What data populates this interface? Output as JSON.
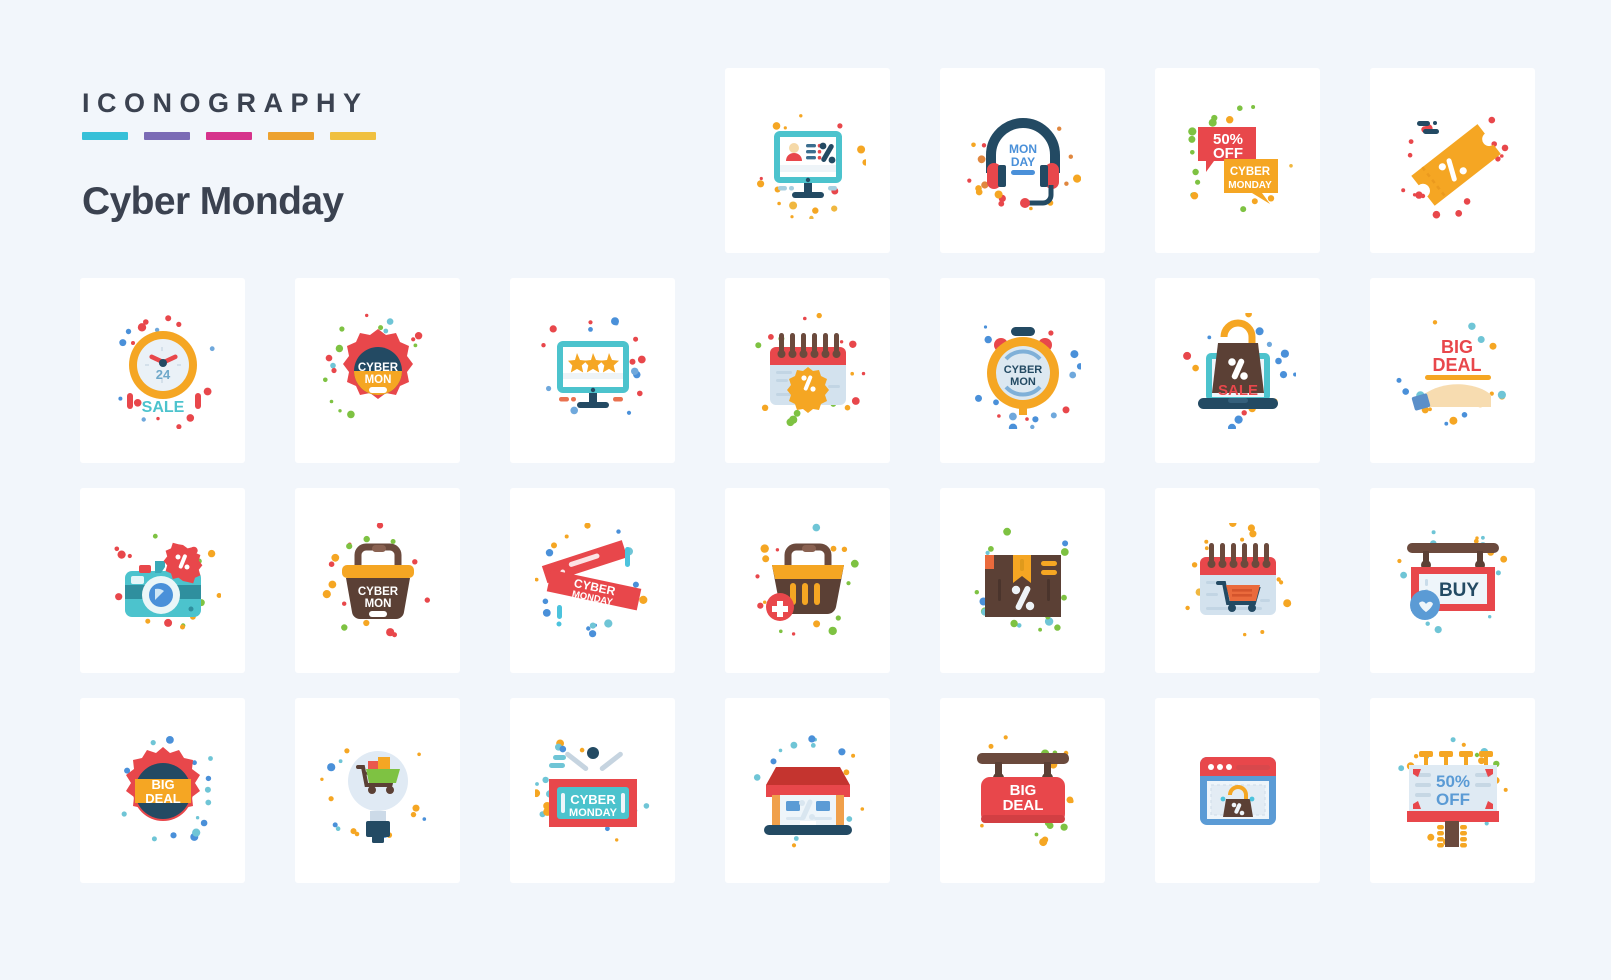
{
  "header": {
    "kicker": "ICONOGRAPHY",
    "pack_name": "Cyber Monday",
    "swatch_colors": [
      "#36c0d8",
      "#7b6bb5",
      "#d6338b",
      "#eda22f",
      "#f0c040"
    ]
  },
  "theme": {
    "page_background": "#f2f6fb",
    "card_background": "#ffffff",
    "text_dark": "#3b4250",
    "accent_red": "#e8474b",
    "accent_yellow": "#f5a623",
    "accent_teal": "#4cc3cd",
    "accent_navy": "#234a63",
    "accent_brown": "#6b4a3d",
    "accent_blue": "#4a90d9",
    "accent_green": "#7ec242"
  },
  "grid": {
    "columns": 7,
    "rows": 4,
    "total_icons": 25
  },
  "icons": [
    {
      "row": 1,
      "col": 1,
      "name": "",
      "type": "empty",
      "labels": []
    },
    {
      "row": 1,
      "col": 2,
      "name": "",
      "type": "empty",
      "labels": []
    },
    {
      "row": 1,
      "col": 3,
      "name": "",
      "type": "empty",
      "labels": []
    },
    {
      "row": 1,
      "col": 4,
      "name": "monitor-discount",
      "type": "monitor-user-percent",
      "labels": []
    },
    {
      "row": 1,
      "col": 5,
      "name": "monday-headphones",
      "type": "headphones",
      "labels": [
        "MON",
        "DAY"
      ]
    },
    {
      "row": 1,
      "col": 6,
      "name": "chat-bubbles-offer",
      "type": "chat-bubbles",
      "labels": [
        "50%",
        "OFF",
        "CYBER",
        "MONDAY"
      ]
    },
    {
      "row": 1,
      "col": 7,
      "name": "discount-coupon-ticket",
      "type": "coupon-percent",
      "labels": []
    },
    {
      "row": 2,
      "col": 1,
      "name": "24-hour-sale-clock",
      "type": "clock-sale",
      "labels": [
        "24",
        "SALE"
      ]
    },
    {
      "row": 2,
      "col": 2,
      "name": "cyber-mon-badge",
      "type": "rosette-badge",
      "labels": [
        "CYBER",
        "MON"
      ]
    },
    {
      "row": 2,
      "col": 3,
      "name": "monitor-rating-stars",
      "type": "monitor-stars",
      "labels": []
    },
    {
      "row": 2,
      "col": 4,
      "name": "calendar-discount",
      "type": "calendar-percent",
      "labels": []
    },
    {
      "row": 2,
      "col": 5,
      "name": "cyber-mon-stopwatch",
      "type": "stopwatch",
      "labels": [
        "CYBER",
        "MON"
      ]
    },
    {
      "row": 2,
      "col": 6,
      "name": "laptop-sale-bag",
      "type": "laptop-bag-sale",
      "labels": [
        "SALE"
      ]
    },
    {
      "row": 2,
      "col": 7,
      "name": "big-deal-hand",
      "type": "hand-big-deal",
      "labels": [
        "BIG",
        "DEAL"
      ]
    },
    {
      "row": 3,
      "col": 1,
      "name": "camera-discount",
      "type": "camera-percent",
      "labels": []
    },
    {
      "row": 3,
      "col": 2,
      "name": "cyber-mon-basket",
      "type": "basket-cyber-mon",
      "labels": [
        "CYBER",
        "MON"
      ]
    },
    {
      "row": 3,
      "col": 3,
      "name": "cyber-monday-tickets",
      "type": "tickets",
      "labels": [
        "CYBER",
        "MONDAY"
      ]
    },
    {
      "row": 3,
      "col": 4,
      "name": "add-to-basket",
      "type": "basket-add",
      "labels": []
    },
    {
      "row": 3,
      "col": 5,
      "name": "discount-package-box",
      "type": "package-percent",
      "labels": []
    },
    {
      "row": 3,
      "col": 6,
      "name": "calendar-shopping-cart",
      "type": "calendar-cart",
      "labels": []
    },
    {
      "row": 3,
      "col": 7,
      "name": "buy-hanging-sign",
      "type": "buy-sign",
      "labels": [
        "BUY"
      ]
    },
    {
      "row": 4,
      "col": 1,
      "name": "big-deal-rosette",
      "type": "rosette-big-deal",
      "labels": [
        "BIG",
        "DEAL"
      ]
    },
    {
      "row": 4,
      "col": 2,
      "name": "shopping-idea-bulb",
      "type": "bulb-cart",
      "labels": []
    },
    {
      "row": 4,
      "col": 3,
      "name": "cyber-monday-hanging-board",
      "type": "hanging-board",
      "labels": [
        "CYBER",
        "MONDAY"
      ]
    },
    {
      "row": 4,
      "col": 4,
      "name": "discount-shop-store",
      "type": "store-percent",
      "labels": []
    },
    {
      "row": 4,
      "col": 5,
      "name": "big-deal-hanging-sign",
      "type": "hanging-big-deal",
      "labels": [
        "BIG",
        "DEAL"
      ]
    },
    {
      "row": 4,
      "col": 6,
      "name": "online-shop-browser",
      "type": "browser-bag",
      "labels": []
    },
    {
      "row": 4,
      "col": 7,
      "name": "50-percent-off-billboard",
      "type": "billboard-offer",
      "labels": [
        "50%",
        "OFF"
      ]
    }
  ]
}
